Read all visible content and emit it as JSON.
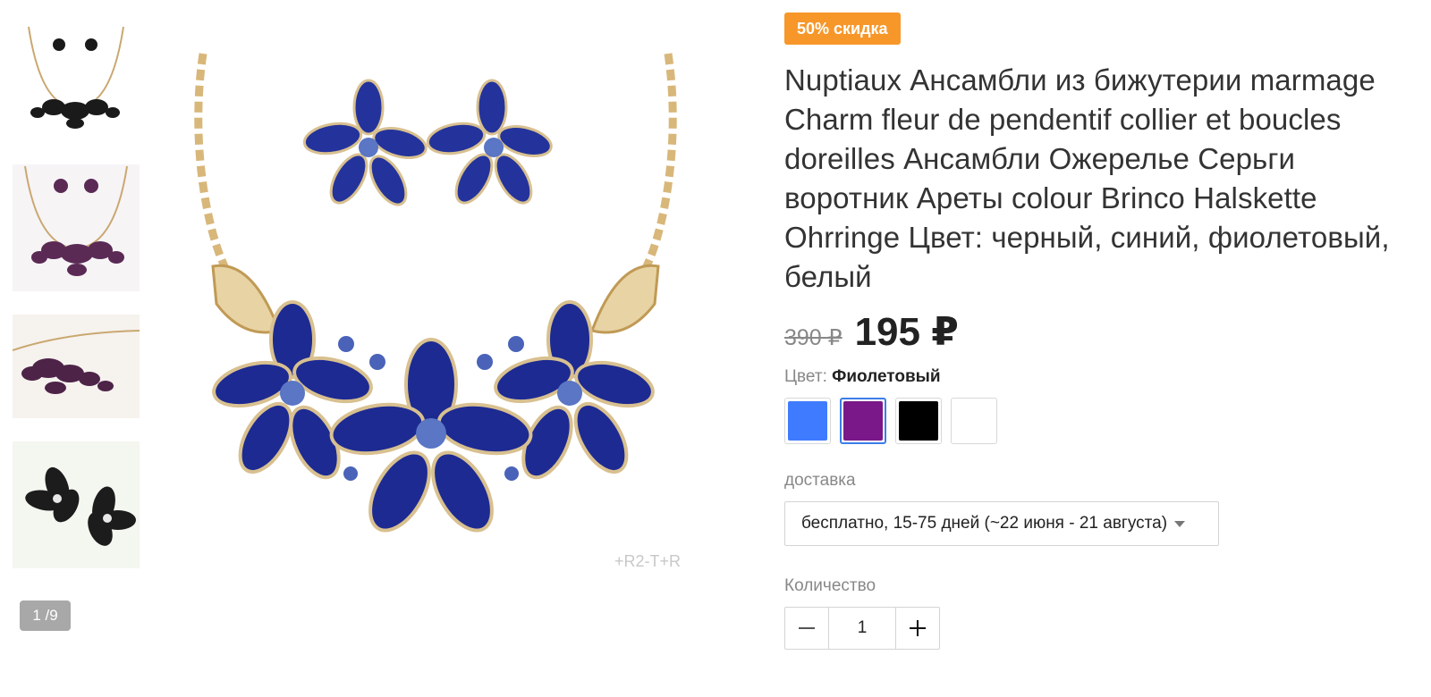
{
  "gallery": {
    "pager": "1 /9",
    "thumbnails": [
      {
        "alt": "black-necklace"
      },
      {
        "alt": "purple-necklace"
      },
      {
        "alt": "purple-necklace-side"
      },
      {
        "alt": "black-earrings"
      }
    ],
    "watermark": "+R2-T+R"
  },
  "product": {
    "discount_badge": "50% скидка",
    "title": "Nuptiaux Ансамбли из бижутерии marmage Charm fleur de pendentif collier et boucles doreilles Ансамбли Ожерелье Серьги воротник Ареты colour Brinco Halskette Ohrringe Цвет: черный, синий, фиолетовый, белый",
    "old_price": "390 ₽",
    "new_price": "195 ₽",
    "color_label": "Цвет:",
    "color_value": "Фиолетовый",
    "swatches": [
      {
        "color": "#3f7bff",
        "selected": false
      },
      {
        "color": "#7a1889",
        "selected": true
      },
      {
        "color": "#000000",
        "selected": false
      },
      {
        "color": "#ffffff",
        "selected": false
      }
    ],
    "shipping_label": "доставка",
    "shipping_value": "бесплатно, 15-75 дней (~22 июня - 21 августа)",
    "quantity_label": "Количество",
    "quantity_value": "1"
  },
  "colors": {
    "badge": "#f7972a",
    "selected_outline": "#3d7de8"
  }
}
